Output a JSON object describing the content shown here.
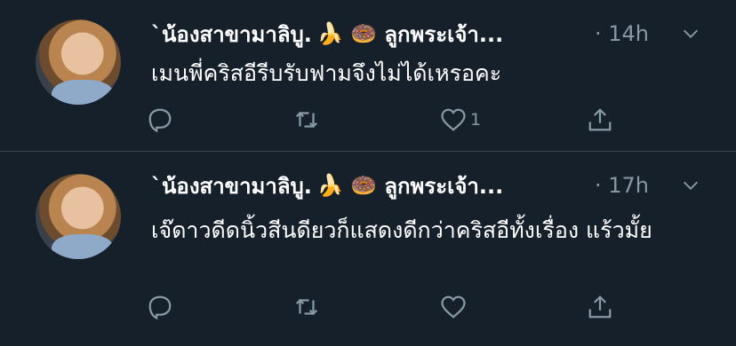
{
  "tweets": [
    {
      "display_name": "`น้องสาขามาลิบู.",
      "emoji": "🍌 🍩",
      "name_suffix": "ลูกพระเจ้า...",
      "time": "· 14h",
      "text": "เมนพี่คริสอีรีบรับฟามจึงไม่ได้เหรอคะ",
      "like_count": "1",
      "avatar_icon": "profile-photo"
    },
    {
      "display_name": "`น้องสาขามาลิบู.",
      "emoji": "🍌 🍩",
      "name_suffix": "ลูกพระเจ้า...",
      "time": "· 17h",
      "text": "เจ๊ดาวดีดนิ้วสีนดียวก็แสดงดีกว่าคริสอีทั้งเรื่อง แร้วมั้ย",
      "like_count": "",
      "avatar_icon": "profile-photo"
    }
  ],
  "icons": {
    "reply": "reply-icon",
    "retweet": "retweet-icon",
    "like": "heart-icon",
    "share": "share-icon",
    "more": "chevron-down-icon"
  },
  "colors": {
    "background": "#15202b",
    "text": "#ffffff",
    "muted": "#8899a6",
    "divider": "#38444d"
  }
}
